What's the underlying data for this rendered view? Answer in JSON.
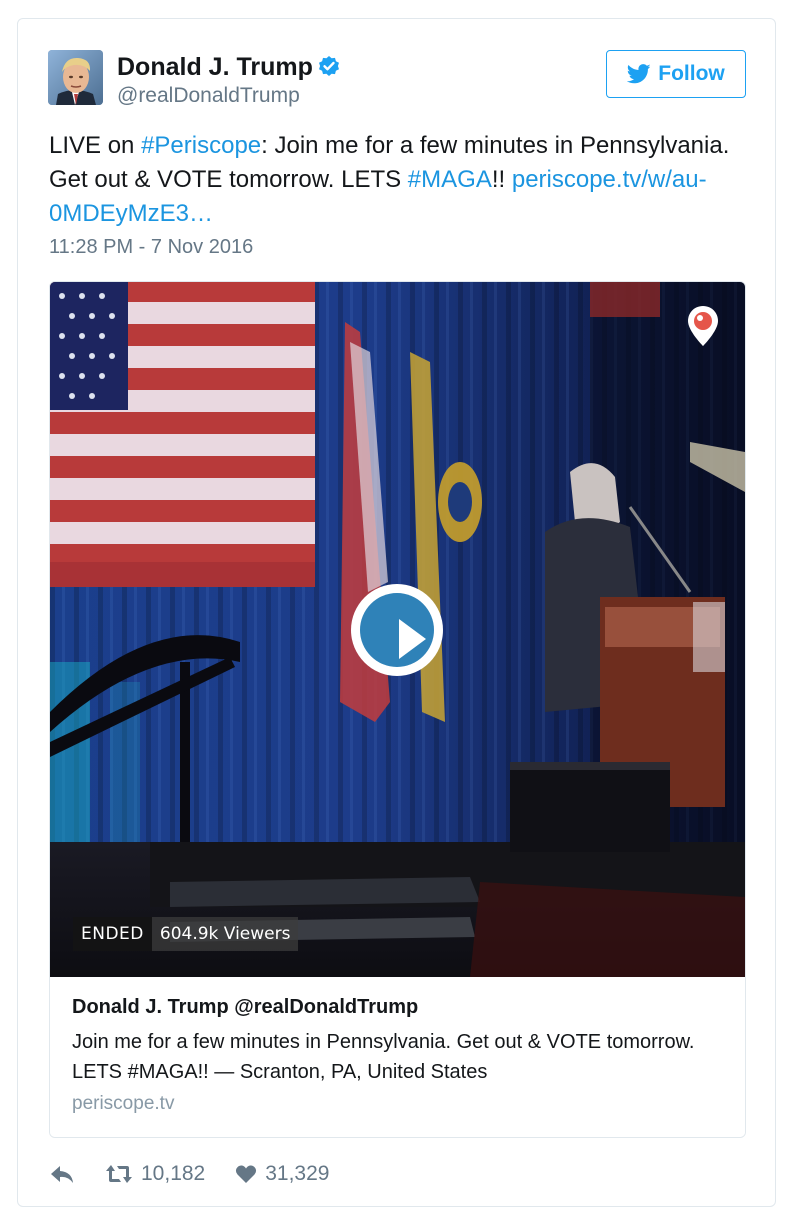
{
  "tweet": {
    "author": {
      "name": "Donald J. Trump",
      "handle": "@realDonaldTrump",
      "verified": true
    },
    "follow_label": "Follow",
    "text": {
      "t1": "LIVE on ",
      "hashtag1": "#Periscope",
      "t2": ": Join me for a few minutes in Pennsylvania. Get out & VOTE tomorrow. LETS ",
      "hashtag2": "#MAGA",
      "t3": "!! ",
      "url": "periscope.tv/w/au-0MDEyMzE3…"
    },
    "timestamp": "11:28 PM - 7 Nov 2016",
    "media": {
      "status_badge": "ENDED",
      "viewers": "604.9k Viewers",
      "card_title": "Donald J. Trump @realDonaldTrump",
      "card_description": "Join me for a few minutes in Pennsylvania. Get out & VOTE tomorrow. LETS #MAGA!! — Scranton, PA, United States",
      "card_domain": "periscope.tv"
    },
    "actions": {
      "retweets": "10,182",
      "likes": "31,329"
    }
  },
  "colors": {
    "link": "#1b95e0",
    "follow": "#1da1f2",
    "verified": "#1da1f2",
    "muted": "#657786",
    "play_button": "#2f82b8",
    "periscope": "#e5564a"
  },
  "icons": [
    "verified-badge-icon",
    "twitter-bird-icon",
    "play-icon",
    "periscope-logo-icon",
    "reply-icon",
    "retweet-icon",
    "heart-icon"
  ]
}
